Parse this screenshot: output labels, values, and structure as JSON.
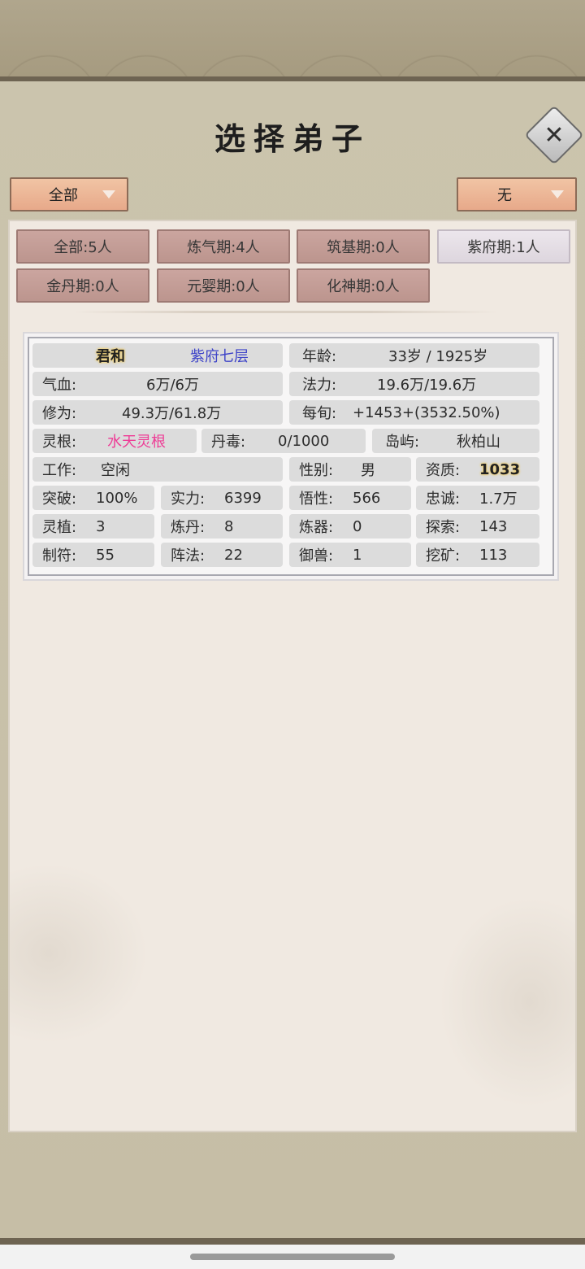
{
  "title": "选择弟子",
  "filters": {
    "left_dropdown": "全部",
    "right_dropdown": "无"
  },
  "realm_tabs": [
    {
      "label": "全部:5人"
    },
    {
      "label": "炼气期:4人"
    },
    {
      "label": "筑基期:0人"
    },
    {
      "label": "紫府期:1人"
    },
    {
      "label": "金丹期:0人"
    },
    {
      "label": "元婴期:0人"
    },
    {
      "label": "化神期:0人"
    }
  ],
  "disciple": {
    "name": "君和",
    "realm": "紫府七层",
    "age_label": "年龄:",
    "age_value": "33岁 / 1925岁",
    "hp_label": "气血:",
    "hp_value": "6万/6万",
    "mana_label": "法力:",
    "mana_value": "19.6万/19.6万",
    "cultivation_label": "修为:",
    "cultivation_value": "49.3万/61.8万",
    "per_period_label": "每旬:",
    "per_period_value": "+1453+(3532.50%)",
    "root_label": "灵根:",
    "root_value": "水天灵根",
    "poison_label": "丹毒:",
    "poison_value": "0/1000",
    "island_label": "岛屿:",
    "island_value": "秋柏山",
    "job_label": "工作:",
    "job_value": "空闲",
    "gender_label": "性别:",
    "gender_value": "男",
    "aptitude_label": "资质:",
    "aptitude_value": "1033",
    "breakthrough_label": "突破:",
    "breakthrough_value": "100%",
    "strength_label": "实力:",
    "strength_value": "6399",
    "comprehension_label": "悟性:",
    "comprehension_value": "566",
    "loyalty_label": "忠诚:",
    "loyalty_value": "1.7万",
    "herb_label": "灵植:",
    "herb_value": "3",
    "alchemy_label": "炼丹:",
    "alchemy_value": "8",
    "forge_label": "炼器:",
    "forge_value": "0",
    "explore_label": "探索:",
    "explore_value": "143",
    "talisman_label": "制符:",
    "talisman_value": "55",
    "formation_label": "阵法:",
    "formation_value": "22",
    "beast_label": "御兽:",
    "beast_value": "1",
    "mining_label": "挖矿:",
    "mining_value": "113"
  }
}
